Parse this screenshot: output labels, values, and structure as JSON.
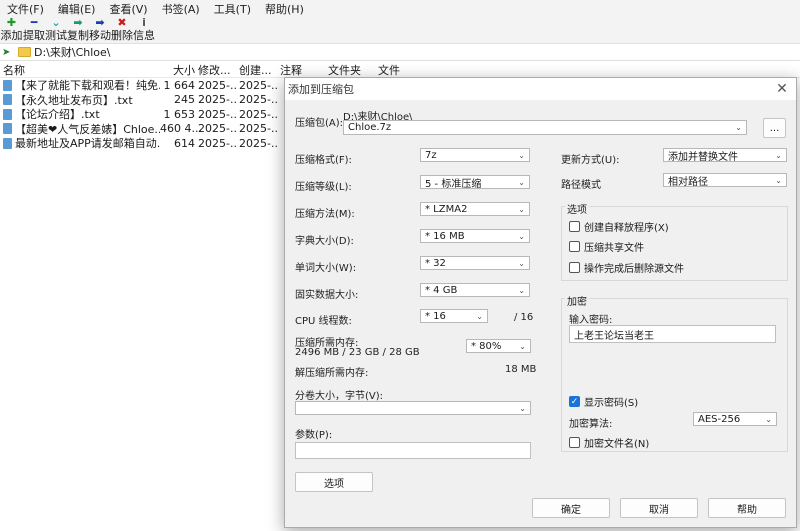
{
  "menu": [
    "文件(F)",
    "编辑(E)",
    "查看(V)",
    "书签(A)",
    "工具(T)",
    "帮助(H)"
  ],
  "toolbar": [
    {
      "label": "添加",
      "icon": "plus-icon",
      "glyph": "✚",
      "color": "#1a9b2a"
    },
    {
      "label": "提取",
      "icon": "minus-icon",
      "glyph": "━",
      "color": "#1a3fb3"
    },
    {
      "label": "测试",
      "icon": "check-icon",
      "glyph": "⌄",
      "color": "#1aa5a5"
    },
    {
      "label": "复制",
      "icon": "arrow-right-icon",
      "glyph": "➡",
      "color": "#1a9b6a"
    },
    {
      "label": "移动",
      "icon": "move-arrow-icon",
      "glyph": "➡",
      "color": "#1a3fb3"
    },
    {
      "label": "删除",
      "icon": "delete-x-icon",
      "glyph": "✖",
      "color": "#cc1a1a"
    },
    {
      "label": "信息",
      "icon": "info-icon",
      "glyph": "i",
      "color": "#555555"
    }
  ],
  "address": {
    "path": "D:\\来财\\Chloe\\"
  },
  "columns": {
    "name": "名称",
    "size": "大小",
    "modified": "修改...",
    "created": "创建...",
    "comment": "注释",
    "folders": "文件夹",
    "files": "文件"
  },
  "files": [
    {
      "name": "【来了就能下载和观看！纯免...",
      "size": "1 664",
      "modified": "2025-...",
      "created": "2025-..."
    },
    {
      "name": "【永久地址发布页】.txt",
      "size": "245",
      "modified": "2025-...",
      "created": "2025-..."
    },
    {
      "name": "【论坛介绍】.txt",
      "size": "1 653",
      "modified": "2025-...",
      "created": "2025-..."
    },
    {
      "name": "【超美❤人气反差婊】Chloe...",
      "size": "460 4...",
      "modified": "2025-...",
      "created": "2025-..."
    },
    {
      "name": "最新地址及APP请发邮箱自动...",
      "size": "614",
      "modified": "2025-...",
      "created": "2025-..."
    }
  ],
  "dialog": {
    "title": "添加到压缩包",
    "archive_label": "压缩包(A):",
    "archive_dir": "D:\\来财\\Chloe\\",
    "archive_name": "Chloe.7z",
    "browse_label": "...",
    "format_label": "压缩格式(F):",
    "format_value": "7z",
    "level_label": "压缩等级(L):",
    "level_value": "5 - 标准压缩",
    "method_label": "压缩方法(M):",
    "method_value": "*  LZMA2",
    "dict_label": "字典大小(D):",
    "dict_value": "*  16 MB",
    "word_label": "单词大小(W):",
    "word_value": "*  32",
    "solid_label": "固实数据大小:",
    "solid_value": "*  4 GB",
    "cpu_label": "CPU 线程数:",
    "cpu_value": "*  16",
    "cpu_max": "/ 16",
    "mem_comp_label": "压缩所需内存:",
    "mem_comp_value": "2496 MB / 23 GB / 28 GB",
    "mem_percent": "* 80%",
    "mem_decomp_label": "解压缩所需内存:",
    "mem_decomp_value": "18 MB",
    "split_label": "分卷大小，字节(V):",
    "split_value": "",
    "params_label": "参数(P):",
    "params_value": "",
    "options_button": "选项",
    "update_label": "更新方式(U):",
    "update_value": "添加并替换文件",
    "pathmode_label": "路径模式",
    "pathmode_value": "相对路径",
    "options_group": "选项",
    "opt_sfx": "创建自释放程序(X)",
    "opt_shared": "压缩共享文件",
    "opt_delete": "操作完成后删除源文件",
    "encrypt_group": "加密",
    "password_label": "输入密码:",
    "password_value": "上老王论坛当老王",
    "show_password": "显示密码(S)",
    "enc_method_label": "加密算法:",
    "enc_method_value": "AES-256",
    "enc_names": "加密文件名(N)",
    "ok": "确定",
    "cancel": "取消",
    "help": "帮助"
  }
}
